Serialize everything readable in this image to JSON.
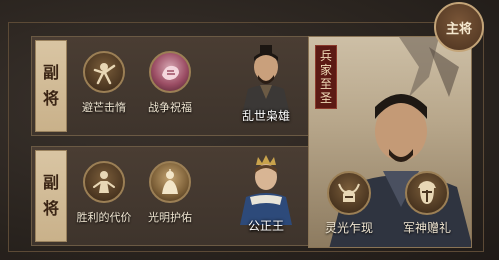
{
  "sub_rows": [
    {
      "side_label": [
        "副",
        "将"
      ],
      "skills": [
        {
          "label": "避芒击惰",
          "icon": "sword-strike-icon"
        },
        {
          "label": "战争祝福",
          "icon": "blessing-hand-icon"
        }
      ],
      "general": {
        "name": "乱世枭雄",
        "icon": "warlord-portrait"
      }
    },
    {
      "side_label": [
        "副",
        "将"
      ],
      "skills": [
        {
          "label": "胜利的代价",
          "icon": "warrior-figure-icon"
        },
        {
          "label": "光明护佑",
          "icon": "cloaked-figure-icon"
        }
      ],
      "general": {
        "name": "公正王",
        "icon": "crowned-king-portrait"
      }
    }
  ],
  "main": {
    "tag": "主将",
    "title_chars": [
      "兵",
      "家",
      "至",
      "圣"
    ],
    "skills": [
      {
        "label": "灵光乍现",
        "icon": "horned-helmet-icon"
      },
      {
        "label": "军神赠礼",
        "icon": "spartan-helmet-icon"
      }
    ],
    "general_icon": "strategist-portrait"
  },
  "colors": {
    "panel_bg": "#4a3d33",
    "label_bg": "#d9c5a3",
    "label_text": "#3a2414",
    "title_bg": "#5b1a14",
    "accent_border": "#9b7f55"
  }
}
